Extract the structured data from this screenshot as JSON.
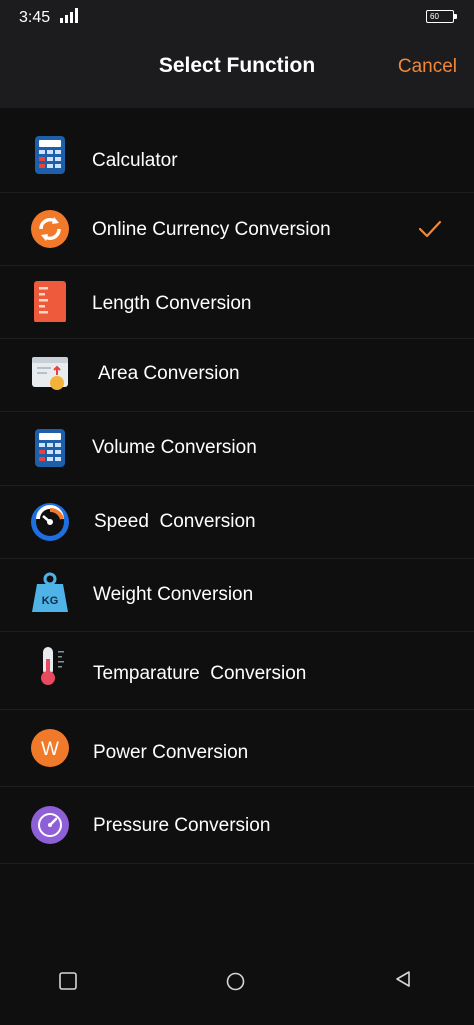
{
  "status_bar": {
    "time": "3:45",
    "battery_level": "60"
  },
  "header": {
    "title": "Select Function",
    "cancel_label": "Cancel"
  },
  "colors": {
    "accent": "#f0883a",
    "background": "#0f0f10",
    "header_background": "#1c1c1e"
  },
  "functions": [
    {
      "label": "Calculator",
      "icon": "calculator-icon",
      "selected": false
    },
    {
      "label": "Online Currency Conversion",
      "icon": "currency-exchange-icon",
      "selected": true
    },
    {
      "label": "Length Conversion",
      "icon": "ruler-icon",
      "selected": false
    },
    {
      "label": "Area Conversion",
      "icon": "area-icon",
      "selected": false
    },
    {
      "label": "Volume Conversion",
      "icon": "volume-calculator-icon",
      "selected": false
    },
    {
      "label": "Speed  Conversion",
      "icon": "speedometer-icon",
      "selected": false
    },
    {
      "label": "Weight Conversion",
      "icon": "weight-kg-icon",
      "selected": false
    },
    {
      "label": "Temparature  Conversion",
      "icon": "thermometer-icon",
      "selected": false
    },
    {
      "label": "Power Conversion",
      "icon": "power-w-icon",
      "selected": false
    },
    {
      "label": "Pressure Conversion",
      "icon": "pressure-gauge-icon",
      "selected": false
    }
  ],
  "icon_text": {
    "weight": "KG",
    "power": "W"
  }
}
